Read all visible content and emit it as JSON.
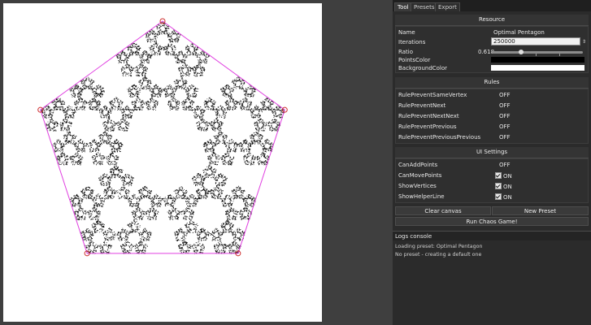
{
  "tabs": [
    {
      "label": "Tool"
    },
    {
      "label": "Presets"
    },
    {
      "label": "Export"
    }
  ],
  "resource": {
    "header": "Resource",
    "name_label": "Name",
    "name_value": "Optimal Pentagon",
    "iterations_label": "Iterations",
    "iterations_value": "250000",
    "ratio_label": "Ratio",
    "ratio_value": "0.618",
    "points_color_label": "PointsColor",
    "points_color": "#000000",
    "background_color_label": "BackgroundColor",
    "background_color": "#ffffff"
  },
  "rules": {
    "header": "Rules",
    "items": [
      {
        "label": "RulePreventSameVertex",
        "value": "OFF"
      },
      {
        "label": "RulePreventNext",
        "value": "OFF"
      },
      {
        "label": "RulePreventNextNext",
        "value": "OFF"
      },
      {
        "label": "RulePreventPrevious",
        "value": "OFF"
      },
      {
        "label": "RulePreventPreviousPrevious",
        "value": "OFF"
      }
    ]
  },
  "ui_settings": {
    "header": "UI Settings",
    "items": [
      {
        "label": "CanAddPoints",
        "value": "OFF"
      },
      {
        "label": "CanMovePoints",
        "value": "ON"
      },
      {
        "label": "ShowVertices",
        "value": "ON"
      },
      {
        "label": "ShowHelperLine",
        "value": "ON"
      }
    ]
  },
  "actions": {
    "clear": "Clear canvas",
    "new_preset": "New Preset",
    "run": "Run Chaos Game!"
  },
  "logs": {
    "header": "Logs console",
    "lines": [
      "Loading preset: Optimal Pentagon",
      "No preset - creating a default one"
    ]
  },
  "colors": {
    "helper_line": "#e040e0",
    "vertex": "#cc2a2a"
  }
}
